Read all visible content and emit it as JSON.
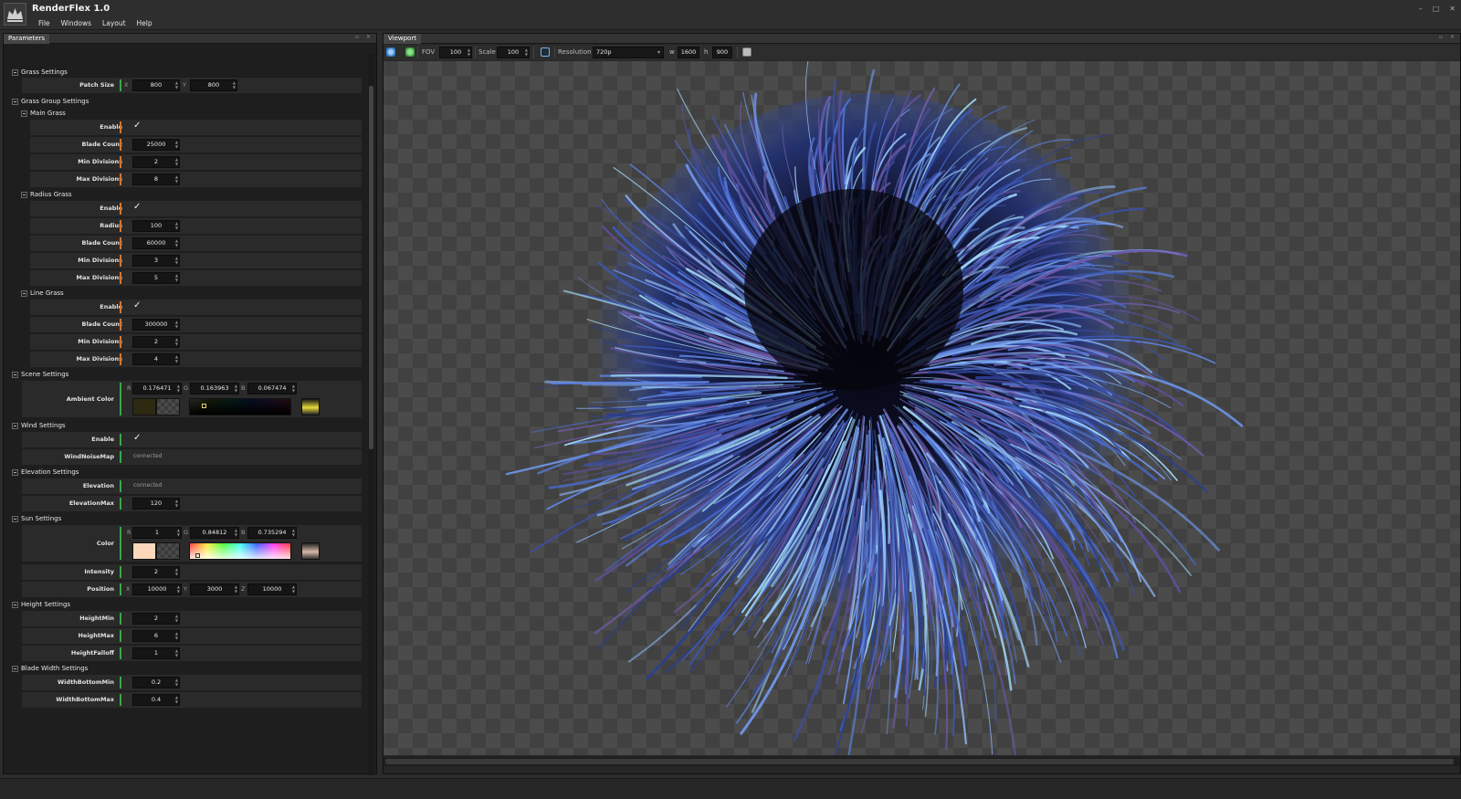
{
  "app": {
    "title": "RenderFlex 1.0",
    "menu": [
      "File",
      "Windows",
      "Layout",
      "Help"
    ],
    "window_controls": [
      "–",
      "□",
      "✕"
    ]
  },
  "colors": {
    "orange_marker": "#d8742a",
    "green_marker": "#36a84a",
    "panel_bg": "#1e1e1e",
    "row_bg": "#2a2a2a"
  },
  "parameters": {
    "panel_title": "Parameters",
    "grass_settings": {
      "title": "Grass Settings",
      "patch_size": {
        "label": "Patch Size",
        "x_label": "X",
        "x": "800",
        "y_label": "Y",
        "y": "800"
      }
    },
    "grass_group_settings": {
      "title": "Grass Group Settings",
      "main_grass": {
        "title": "Main Grass",
        "enable_label": "Enable",
        "enable_check": "✓",
        "blade_count_label": "Blade Count",
        "blade_count": "25000",
        "min_div_label": "Min Divisions",
        "min_div": "2",
        "max_div_label": "Max Divisions",
        "max_div": "8"
      },
      "radius_grass": {
        "title": "Radius Grass",
        "enable_label": "Enable",
        "enable_check": "✓",
        "radius_label": "Radius",
        "radius": "100",
        "blade_count_label": "Blade Count",
        "blade_count": "60000",
        "min_div_label": "Min Divisions",
        "min_div": "3",
        "max_div_label": "Max Divisions",
        "max_div": "5"
      },
      "line_grass": {
        "title": "Line Grass",
        "enable_label": "Enable",
        "enable_check": "✓",
        "blade_count_label": "Blade Count",
        "blade_count": "300000",
        "min_div_label": "Min Divisions",
        "min_div": "2",
        "max_div_label": "Max Divisions",
        "max_div": "4"
      }
    },
    "scene_settings": {
      "title": "Scene Settings",
      "ambient_label": "Ambient Color",
      "r_label": "R",
      "r": "0.176471",
      "g_label": "G",
      "g": "0.163963",
      "b_label": "B",
      "b": "0.067474",
      "swatch_color": "#2d2a11"
    },
    "wind_settings": {
      "title": "Wind Settings",
      "enable_label": "Enable",
      "enable_check": "✓",
      "noise_label": "WindNoiseMap",
      "noise_value": "connected"
    },
    "elevation_settings": {
      "title": "Elevation Settings",
      "elevation_label": "Elevation",
      "elevation_value": "connected",
      "elevation_max_label": "ElevationMax",
      "elevation_max": "120"
    },
    "sun_settings": {
      "title": "Sun Settings",
      "color_label": "Color",
      "r_label": "R",
      "r": "1",
      "g_label": "G",
      "g": "0.84812",
      "b_label": "B",
      "b": "0.735294",
      "swatch_color": "#ffd8bb",
      "intensity_label": "Intensity",
      "intensity": "2",
      "position_label": "Position",
      "px_label": "X",
      "px": "10000",
      "py_label": "Y",
      "py": "3000",
      "pz_label": "Z",
      "pz": "10000"
    },
    "height_settings": {
      "title": "Height Settings",
      "min_label": "HeightMin",
      "min": "2",
      "max_label": "HeightMax",
      "max": "6",
      "falloff_label": "HeightFalloff",
      "falloff": "1"
    },
    "blade_width_settings": {
      "title": "Blade Width Settings",
      "bottom_min_label": "WidthBottomMin",
      "bottom_min": "0.2",
      "bottom_max_label": "WidthBottomMax",
      "bottom_max": "0.4"
    }
  },
  "viewport": {
    "panel_title": "Viewport",
    "fov_label": "FOV",
    "fov": "100",
    "scale_label": "Scale",
    "scale": "100",
    "resolution_label": "Resolution",
    "resolution": "720p",
    "w_label": "w",
    "w": "1600",
    "h_label": "h",
    "h": "900"
  }
}
